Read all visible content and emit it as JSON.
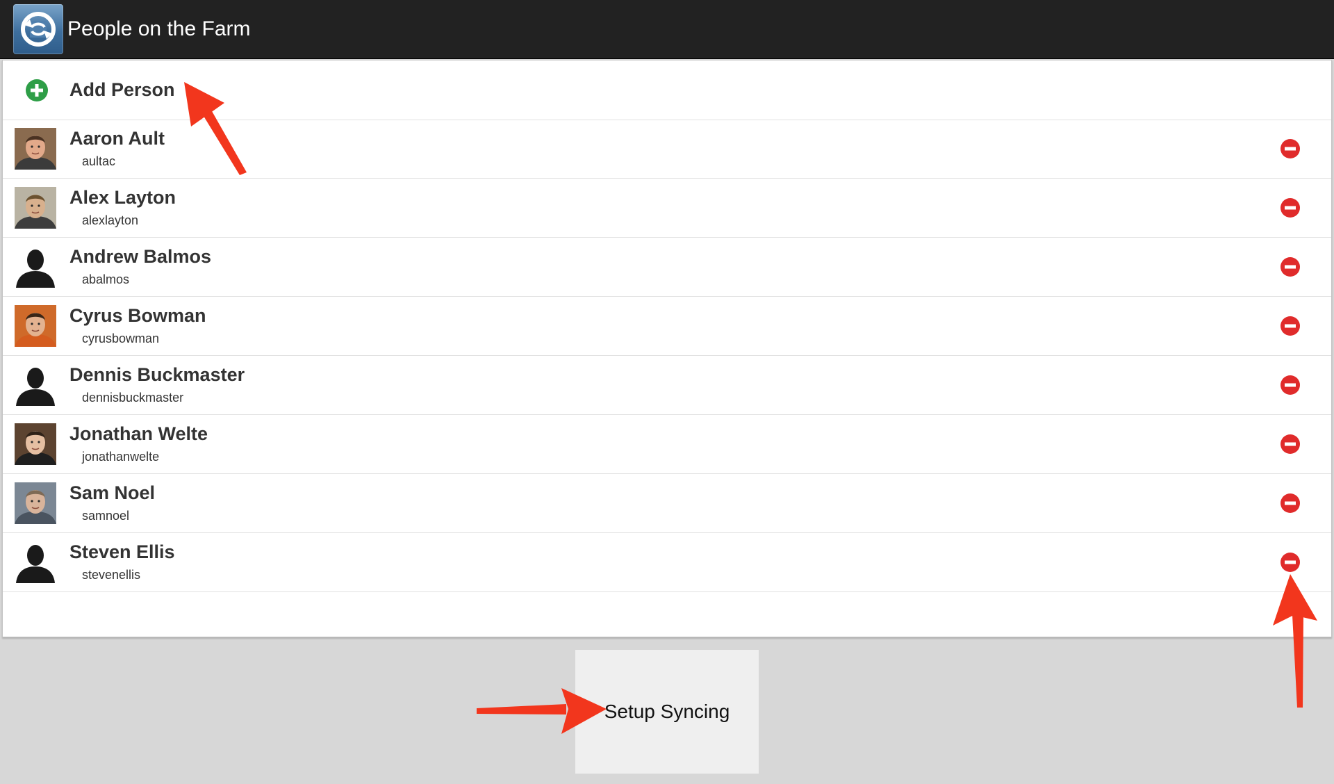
{
  "header": {
    "title": "People on the Farm",
    "icon": "sync-app-icon"
  },
  "list": {
    "add_label": "Add Person",
    "add_icon": "add-circle-icon",
    "remove_icon": "remove-circle-icon",
    "people": [
      {
        "name": "Aaron Ault",
        "username": "aultac",
        "avatar": "photo"
      },
      {
        "name": "Alex Layton",
        "username": "alexlayton",
        "avatar": "photo"
      },
      {
        "name": "Andrew Balmos",
        "username": "abalmos",
        "avatar": "silhouette"
      },
      {
        "name": "Cyrus Bowman",
        "username": "cyrusbowman",
        "avatar": "photo"
      },
      {
        "name": "Dennis Buckmaster",
        "username": "dennisbuckmaster",
        "avatar": "silhouette"
      },
      {
        "name": "Jonathan Welte",
        "username": "jonathanwelte",
        "avatar": "photo"
      },
      {
        "name": "Sam Noel",
        "username": "samnoel",
        "avatar": "photo"
      },
      {
        "name": "Steven Ellis",
        "username": "stevenellis",
        "avatar": "silhouette"
      }
    ]
  },
  "footer": {
    "setup_label": "Setup Syncing"
  },
  "colors": {
    "actionbar": "#222222",
    "add_green": "#2e9e47",
    "remove_red": "#e02b2b",
    "annotation_arrow": "#f2361d"
  }
}
